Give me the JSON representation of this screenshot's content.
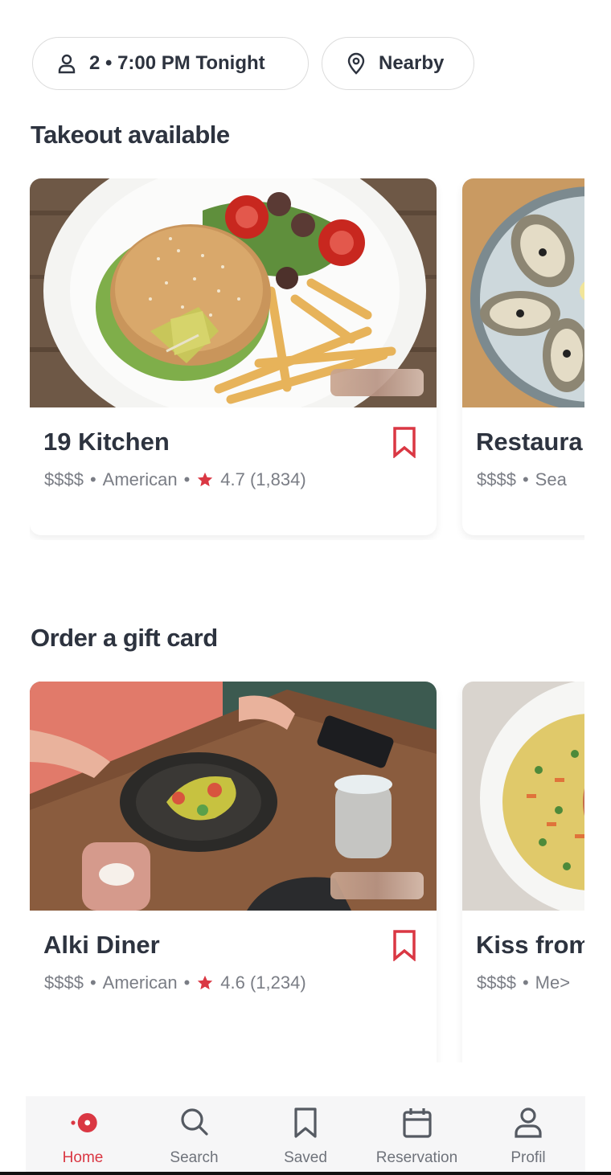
{
  "filters": {
    "party": "2 • 7:00 PM Tonight",
    "location": "Nearby"
  },
  "sections": [
    {
      "title": "Takeout available",
      "cards": [
        {
          "name": "19 Kitchen",
          "price": "$$$$",
          "cuisine": "American",
          "rating": "4.7 (1,834)",
          "photo": "burger-plate"
        },
        {
          "name": "Restaura",
          "price": "$$$$",
          "cuisine": "Sea",
          "photo": "oysters-tray"
        }
      ]
    },
    {
      "title": "Order a gift card",
      "cards": [
        {
          "name": "Alki Diner",
          "price": "$$$$",
          "cuisine": "American",
          "rating": "4.6 (1,234)",
          "photo": "dinner-table"
        },
        {
          "name": "Kiss from",
          "price": "$$$$",
          "cuisine": "Me>",
          "photo": "rice-plate"
        }
      ]
    }
  ],
  "nav": {
    "items": [
      {
        "label": "Home",
        "icon": "home-icon",
        "active": true
      },
      {
        "label": "Search",
        "icon": "search-icon"
      },
      {
        "label": "Saved",
        "icon": "bookmark-icon"
      },
      {
        "label": "Reservation",
        "icon": "calendar-icon"
      },
      {
        "label": "Profil",
        "icon": "user-icon"
      }
    ]
  },
  "colors": {
    "accent": "#da3743",
    "text": "#2d333f",
    "muted": "#7a7d85"
  }
}
